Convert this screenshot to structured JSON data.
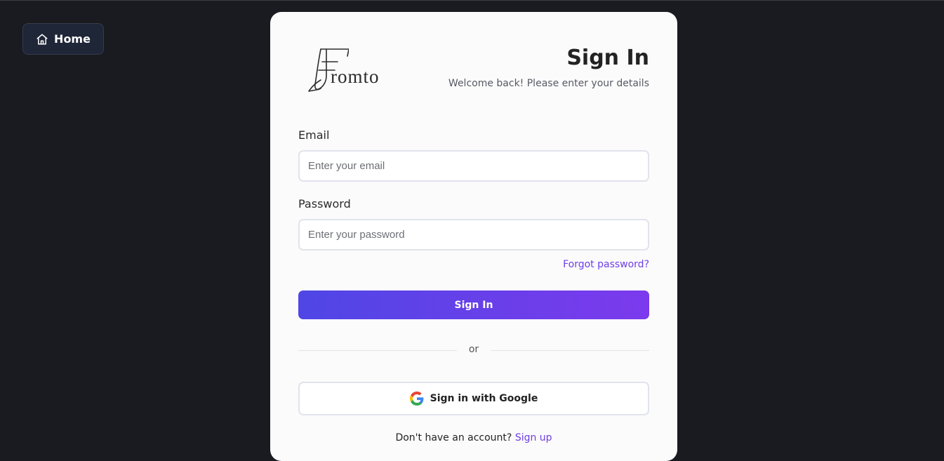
{
  "nav": {
    "home_label": "Home",
    "home_icon": "home-icon"
  },
  "brand": {
    "logo_text": "romto",
    "logo_icon": "fromto-f-logo-icon"
  },
  "header": {
    "title": "Sign In",
    "subtitle": "Welcome back! Please enter your details"
  },
  "form": {
    "email_label": "Email",
    "email_placeholder": "Enter your email",
    "email_value": "",
    "password_label": "Password",
    "password_placeholder": "Enter your password",
    "password_value": "",
    "forgot_label": "Forgot password?",
    "submit_label": "Sign In"
  },
  "divider": {
    "label": "or"
  },
  "google": {
    "label": "Sign in with Google",
    "icon": "google-icon"
  },
  "footer": {
    "prompt": "Don't have an account?",
    "link_label": "Sign up"
  },
  "colors": {
    "page_background": "#191b20",
    "card_background": "#fcfbfc",
    "accent_start": "#4f46e5",
    "accent_end": "#7c3aed",
    "link": "#6d3ee6"
  }
}
